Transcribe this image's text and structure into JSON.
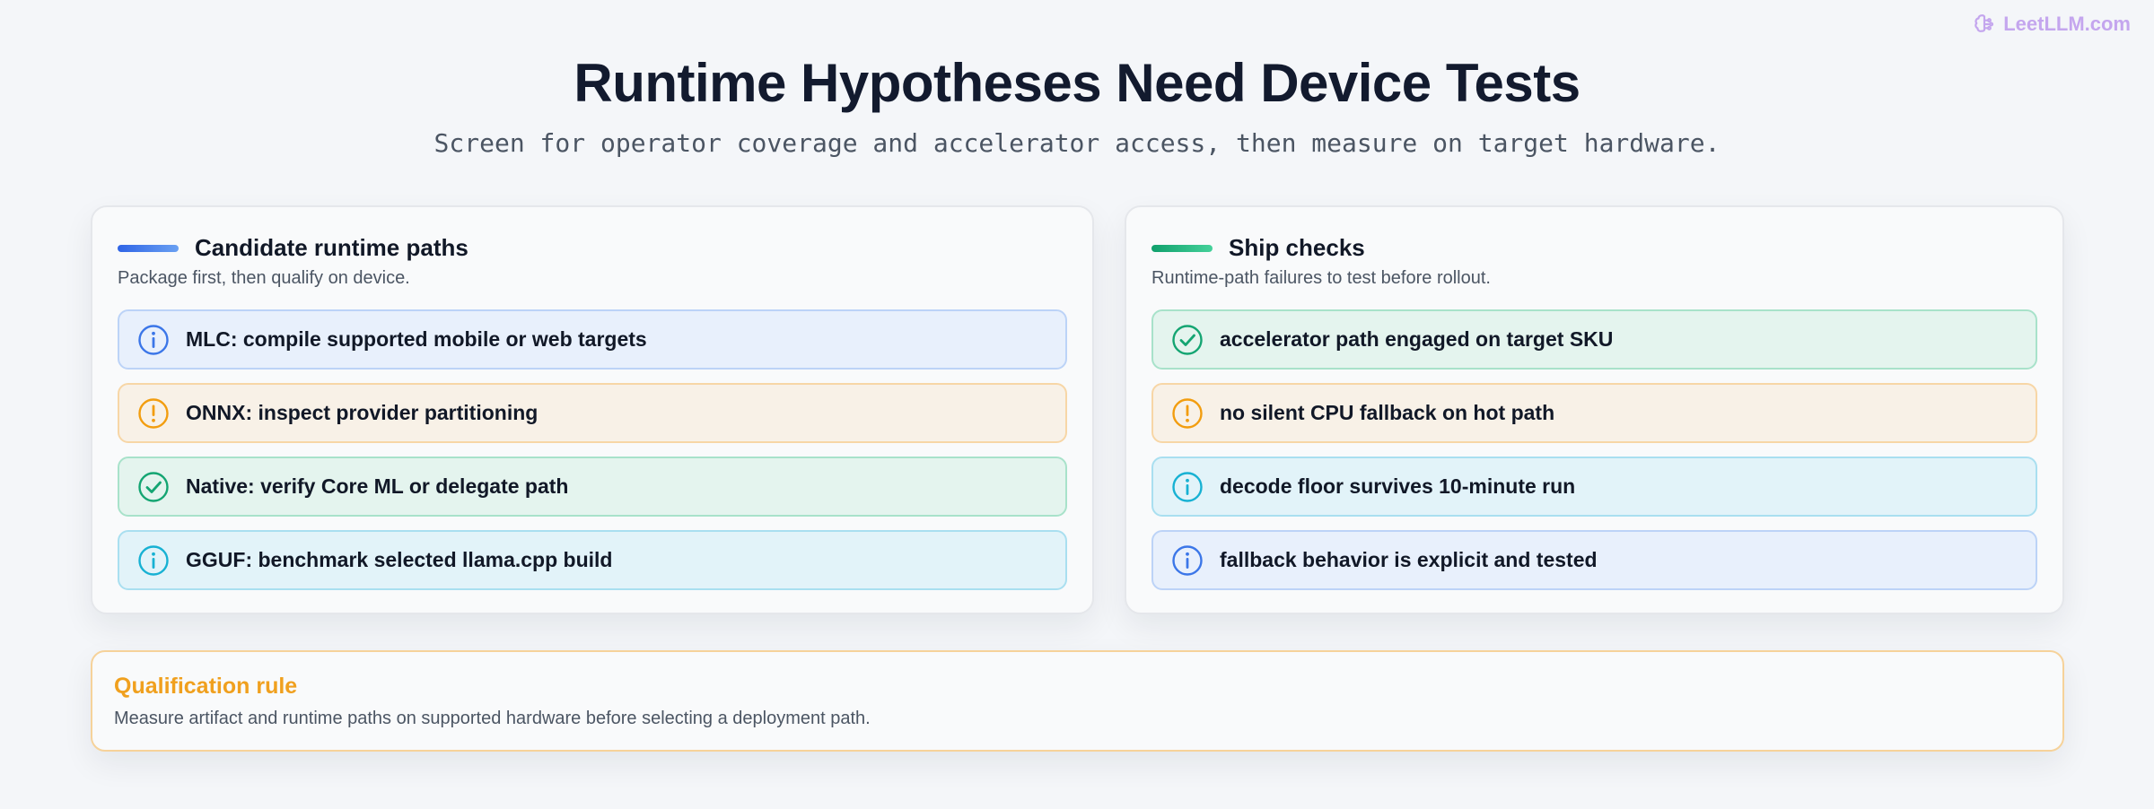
{
  "brand": {
    "logo_icon": "brain-circuit-icon",
    "text": "LeetLLM.com",
    "color": "#c4a6ee"
  },
  "header": {
    "title": "Runtime Hypotheses Need Device Tests",
    "subtitle": "Screen for operator coverage and accelerator access, then measure on target hardware."
  },
  "left_card": {
    "accent": "#2f64e6",
    "title": "Candidate runtime paths",
    "subtitle": "Package first, then qualify on device.",
    "items": [
      {
        "label": "MLC: compile supported mobile or web targets",
        "icon": "info-icon",
        "tone": "blue"
      },
      {
        "label": "ONNX: inspect provider partitioning",
        "icon": "warning-icon",
        "tone": "orange"
      },
      {
        "label": "Native: verify Core ML or delegate path",
        "icon": "check-icon",
        "tone": "green"
      },
      {
        "label": "GGUF: benchmark selected llama.cpp build",
        "icon": "info-icon",
        "tone": "cyan"
      }
    ]
  },
  "right_card": {
    "accent": "#10a06c",
    "title": "Ship checks",
    "subtitle": "Runtime-path failures to test before rollout.",
    "items": [
      {
        "label": "accelerator path engaged on target SKU",
        "icon": "check-icon",
        "tone": "green"
      },
      {
        "label": "no silent CPU fallback on hot path",
        "icon": "warning-icon",
        "tone": "orange"
      },
      {
        "label": "decode floor survives 10-minute run",
        "icon": "info-icon",
        "tone": "cyan"
      },
      {
        "label": "fallback behavior is explicit and tested",
        "icon": "info-icon",
        "tone": "blue"
      }
    ]
  },
  "rule": {
    "title": "Qualification rule",
    "text": "Measure artifact and runtime paths on supported hardware before selecting a deployment path.",
    "color": "#f0a01e"
  },
  "colors": {
    "blue": "#3b76e8",
    "orange": "#f29d0f",
    "green": "#14a572",
    "cyan": "#17b1d3"
  }
}
